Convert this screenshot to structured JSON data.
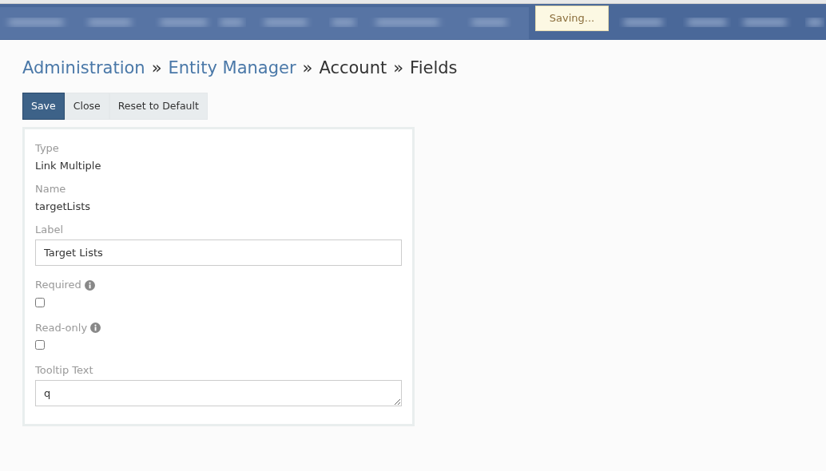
{
  "notice": {
    "text": "Saving..."
  },
  "breadcrumb": [
    {
      "text": "Administration",
      "link": true
    },
    {
      "text": "Entity Manager",
      "link": true
    },
    {
      "text": "Account",
      "link": false
    },
    {
      "text": "Fields",
      "link": false
    }
  ],
  "breadcrumb_separator": "»",
  "buttons": [
    {
      "label": "Save",
      "primary": true
    },
    {
      "label": "Close",
      "primary": false
    },
    {
      "label": "Reset to Default",
      "primary": false
    }
  ],
  "fields": [
    {
      "kind": "static",
      "label": "Type",
      "value": "Link Multiple"
    },
    {
      "kind": "static",
      "label": "Name",
      "value": "targetLists"
    },
    {
      "kind": "input",
      "label": "Label",
      "value": "Target Lists"
    },
    {
      "kind": "checkbox",
      "label": "Required",
      "info": true,
      "checked": false
    },
    {
      "kind": "checkbox",
      "label": "Read-only",
      "info": true,
      "checked": false
    },
    {
      "kind": "textarea",
      "label": "Tooltip Text",
      "value": "q"
    }
  ]
}
